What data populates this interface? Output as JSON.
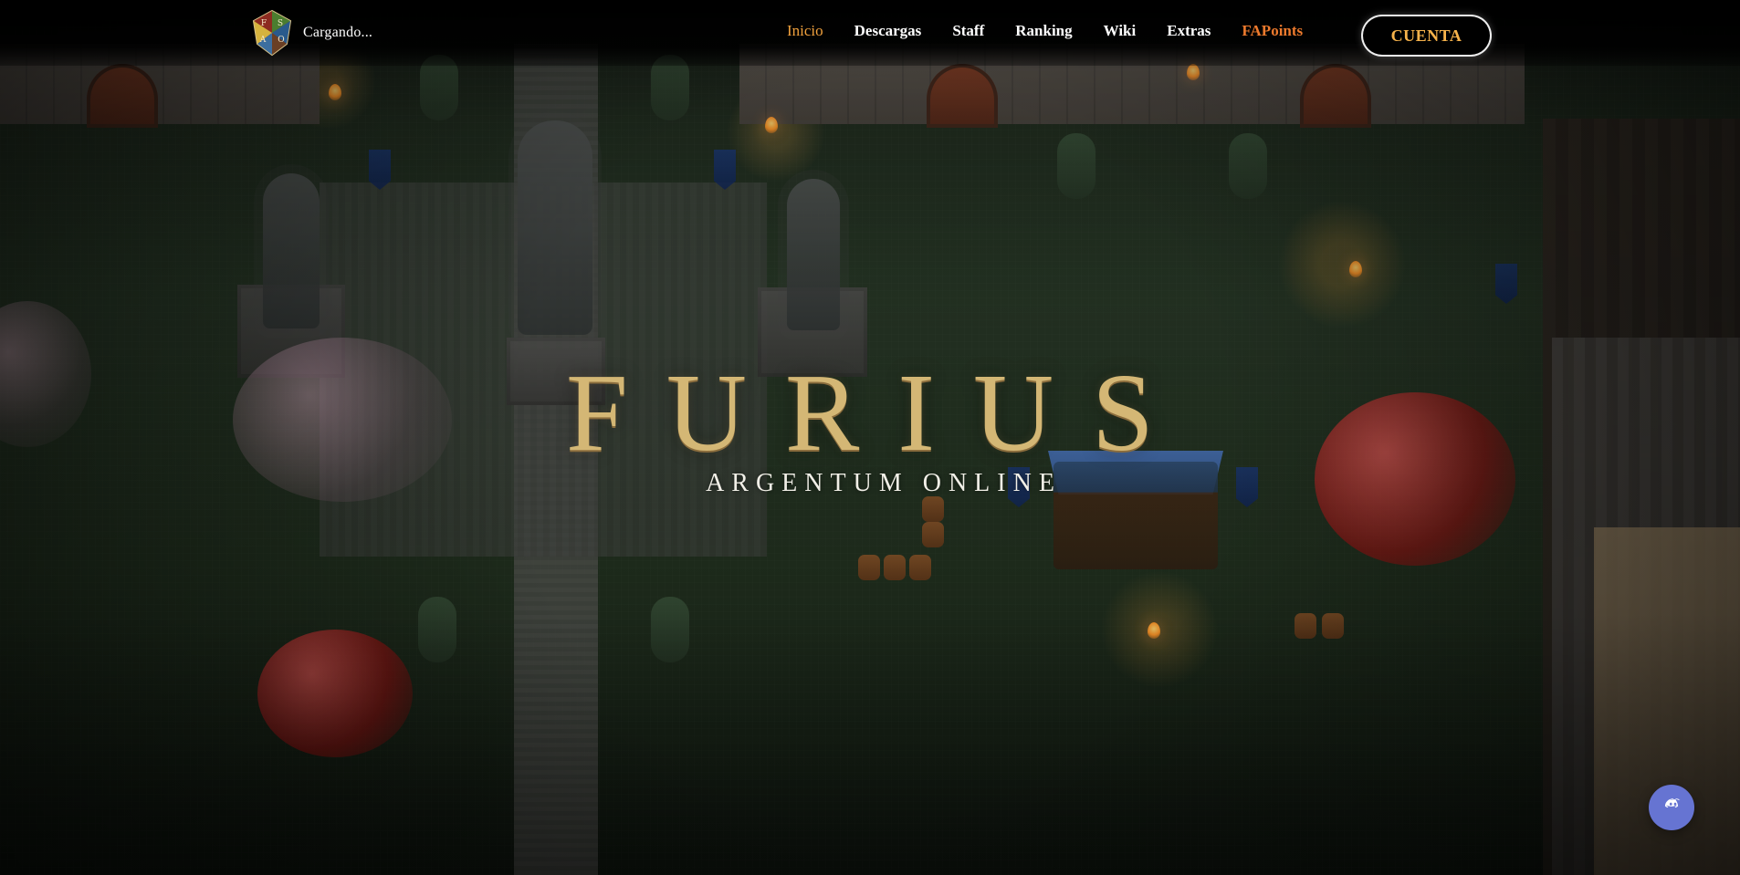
{
  "header": {
    "status_text": "Cargando...",
    "nav": [
      {
        "label": "Inicio"
      },
      {
        "label": "Descargas"
      },
      {
        "label": "Staff"
      },
      {
        "label": "Ranking"
      },
      {
        "label": "Wiki"
      },
      {
        "label": "Extras"
      },
      {
        "label": "FAPoints"
      }
    ],
    "account_button": "CUENTA",
    "crest_letters": [
      "F",
      "S",
      "A",
      "O"
    ]
  },
  "hero": {
    "title": "FURIUS",
    "subtitle": "ARGENTUM ONLINE"
  },
  "icons": {
    "logo": "crest-icon",
    "discord": "discord-icon"
  },
  "colors": {
    "active_nav": "#f0a13d",
    "fapoints": "#ee7a2d",
    "account_text": "#f7b34b",
    "discord": "#6674d2",
    "logo_gold": "#d4b775"
  }
}
